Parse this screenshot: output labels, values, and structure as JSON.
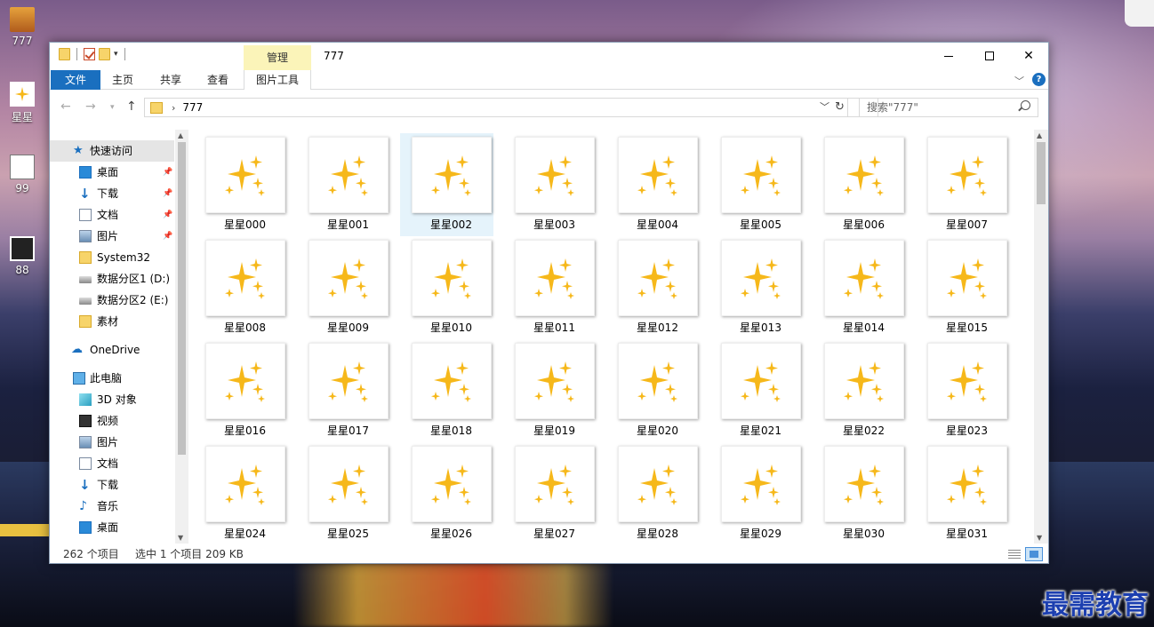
{
  "desktop": {
    "icons": [
      {
        "label": "777"
      },
      {
        "label": "星星"
      },
      {
        "label": "99"
      },
      {
        "label": "88"
      }
    ]
  },
  "window": {
    "title": "777",
    "context_tab_group": "管理",
    "tabs": {
      "file": "文件",
      "home": "主页",
      "share": "共享",
      "view": "查看",
      "picture_tools": "图片工具"
    },
    "address_path": "777",
    "search_placeholder": "搜索\"777\"",
    "help_label": "?"
  },
  "nav_pane": {
    "quick_access": "快速访问",
    "items_quick": [
      "桌面",
      "下载",
      "文档",
      "图片",
      "System32",
      "数据分区1 (D:)",
      "数据分区2 (E:)",
      "素材"
    ],
    "onedrive": "OneDrive",
    "this_pc": "此电脑",
    "items_pc": [
      "3D 对象",
      "视频",
      "图片",
      "文档",
      "下载",
      "音乐",
      "桌面"
    ]
  },
  "content": {
    "selected_index": 2,
    "files": [
      "星星000",
      "星星001",
      "星星002",
      "星星003",
      "星星004",
      "星星005",
      "星星006",
      "星星007",
      "星星008",
      "星星009",
      "星星010",
      "星星011",
      "星星012",
      "星星013",
      "星星014",
      "星星015",
      "星星016",
      "星星017",
      "星星018",
      "星星019",
      "星星020",
      "星星021",
      "星星022",
      "星星023",
      "星星024",
      "星星025",
      "星星026",
      "星星027",
      "星星028",
      "星星029",
      "星星030",
      "星星031"
    ],
    "thumbnail_icon": "sparkle-stars-icon",
    "thumbnail_color": "#f6b81a"
  },
  "status_bar": {
    "item_count": "262 个项目",
    "selection": "选中 1 个项目  209 KB"
  },
  "watermark": "最需教育"
}
